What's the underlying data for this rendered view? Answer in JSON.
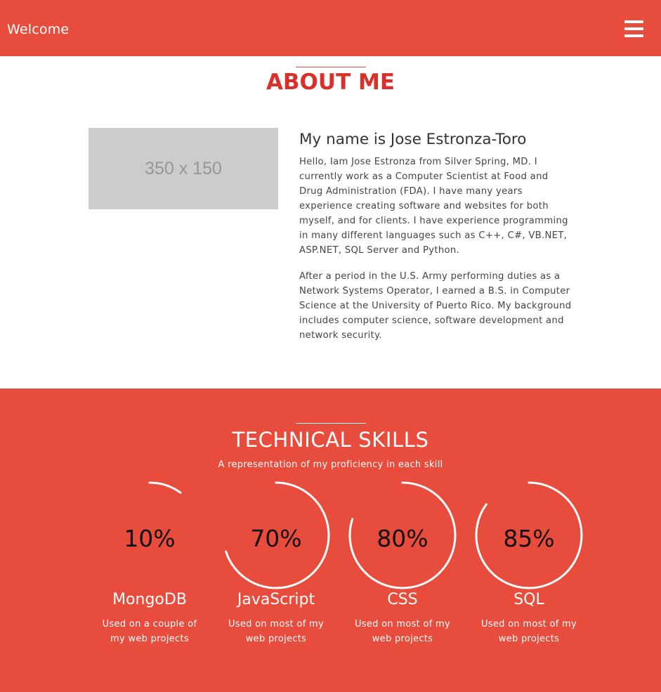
{
  "header": {
    "brand": "Welcome",
    "menu_icon": "hamburger-menu-icon"
  },
  "about": {
    "title": "ABOUT ME",
    "image_placeholder": "350 x 150",
    "name_heading": "My name is Jose Estronza-Toro",
    "paragraphs": [
      "Hello, Iam Jose Estronza from Silver Spring, MD. I currently work as a Computer Scientist at Food and Drug Administration (FDA). I have many years experience creating software and websites for both myself, and for clients. I have experience programming in many different languages such as C++, C#, VB.NET, ASP.NET, SQL Server and Python.",
      "After a period in the U.S. Army performing duties as a Network Systems Operator, I earned a B.S. in Computer Science at the University of Puerto Rico. My background includes computer science, software development and network security."
    ]
  },
  "skills": {
    "title": "TECHNICAL SKILLS",
    "subtitle": "A representation of my proficiency in each skill",
    "items": [
      {
        "percent_label": "10%",
        "value": 10,
        "name": "MongoDB",
        "description": "Used on a couple of my web projects"
      },
      {
        "percent_label": "70%",
        "value": 70,
        "name": "JavaScript",
        "description": "Used on most of my web projects"
      },
      {
        "percent_label": "80%",
        "value": 80,
        "name": "CSS",
        "description": "Used on most of my web projects"
      },
      {
        "percent_label": "85%",
        "value": 85,
        "name": "SQL",
        "description": "Used on most of my web projects"
      }
    ]
  },
  "colors": {
    "accent": "#e74c3c",
    "title_red": "#d9302a",
    "placeholder_gray": "#cccccc"
  }
}
